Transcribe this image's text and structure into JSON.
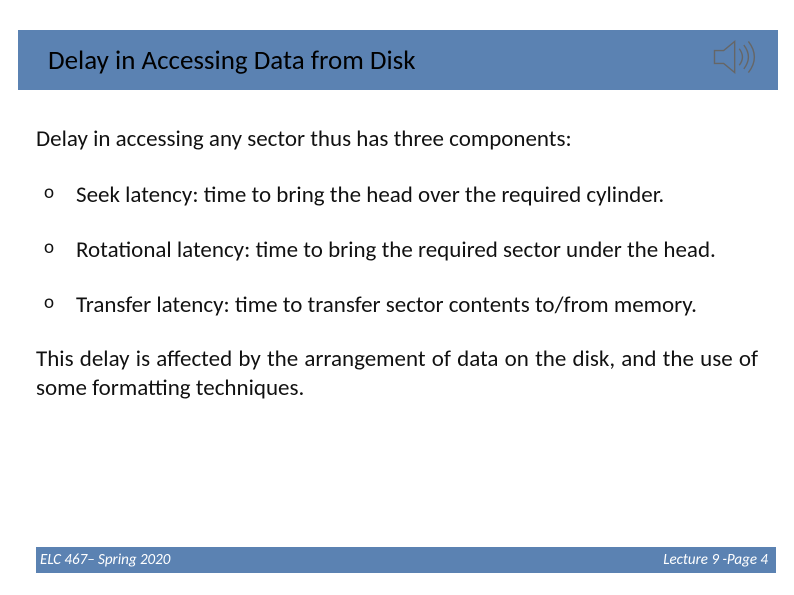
{
  "title": "Delay in Accessing Data from Disk",
  "intro": "Delay in accessing any sector thus has three components:",
  "bullets": [
    "Seek latency:  time to bring the head over the required cylinder.",
    "Rotational latency: time to bring the required sector under the head.",
    "Transfer latency: time to transfer sector contents to/from memory."
  ],
  "bullet_marker": "o",
  "outro": "This delay is affected by the arrangement of data on the disk, and the use of some formatting techniques.",
  "footer": {
    "left": "ELC 467– Spring 2020",
    "right": "Lecture 9 -Page 4"
  },
  "colors": {
    "accent": "#5b82b2"
  },
  "icon_name": "speaker-icon"
}
